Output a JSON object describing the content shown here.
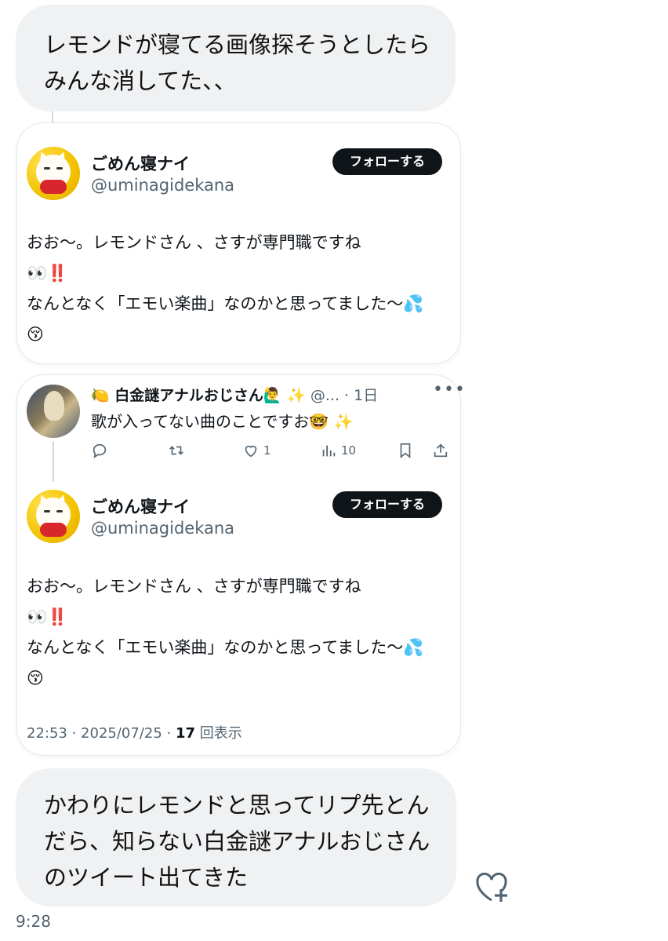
{
  "messages": {
    "top": {
      "text": "レモンドが寝てる画像探そうとしたらみんな消してた、、"
    },
    "bottom": {
      "text": "かわりにレモンドと思ってリプ先とんだら、知らない白金謎アナルおじさんのツイート出てきた"
    },
    "timestamp": "9:28"
  },
  "quoted_tweet": {
    "author_name": "ごめん寝ナイ",
    "handle": "@uminagidekana",
    "follow_label": "フォローする",
    "text": "おお〜。レモンドさん 、さすが専門職ですね\n👀‼️\nなんとなく「エモい楽曲」なのかと思ってました〜💦😚"
  },
  "thread": {
    "reply": {
      "author_name": "🍋 白金謎アナルおじさん🙋‍♂️ ✨",
      "handle_time": "@... · 1日",
      "more_icon": "more-dots-icon",
      "text": "歌が入ってない曲のことですお🤓 ✨",
      "actions": {
        "reply": "",
        "retweet": "",
        "likes": "1",
        "views": "10"
      }
    },
    "main": {
      "author_name": "ごめん寝ナイ",
      "handle": "@uminagidekana",
      "follow_label": "フォローする",
      "text": "おお〜。レモンドさん 、さすが専門職ですね\n👀‼️\nなんとなく「エモい楽曲」なのかと思ってました〜💦😚",
      "meta_time": "22:53 · 2025/07/25 · ",
      "meta_views": "17",
      "meta_views_label": " 回表示"
    }
  },
  "colors": {
    "bubble_bg": "#eff1f3",
    "follow_bg": "#0f1419",
    "secondary_text": "#536471",
    "thread_line": "#cfd9de"
  }
}
